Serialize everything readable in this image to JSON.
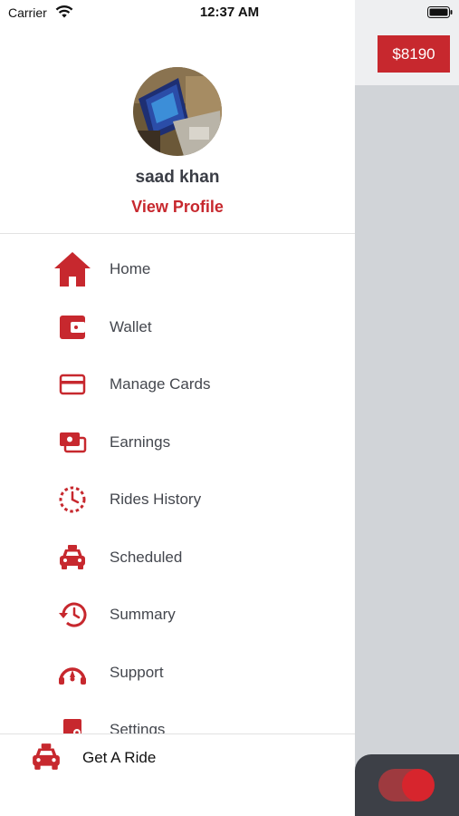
{
  "status_bar": {
    "carrier": "Carrier",
    "time": "12:37 AM"
  },
  "background": {
    "balance": "$8190"
  },
  "drawer": {
    "user_name": "saad khan",
    "view_profile": "View Profile",
    "menu": [
      {
        "label": "Home",
        "icon": "home-icon"
      },
      {
        "label": "Wallet",
        "icon": "wallet-icon"
      },
      {
        "label": "Manage Cards",
        "icon": "credit-card-icon"
      },
      {
        "label": "Earnings",
        "icon": "earnings-icon"
      },
      {
        "label": "Rides History",
        "icon": "clock-icon"
      },
      {
        "label": "Scheduled",
        "icon": "taxi-icon"
      },
      {
        "label": "Summary",
        "icon": "history-icon"
      },
      {
        "label": "Support",
        "icon": "support-icon"
      },
      {
        "label": "Settings",
        "icon": "settings-icon"
      }
    ],
    "footer_action": {
      "label": "Get A Ride",
      "icon": "taxi-icon"
    }
  },
  "colors": {
    "accent": "#c7282e",
    "text": "#44474e",
    "dark_card": "#3d4047"
  }
}
